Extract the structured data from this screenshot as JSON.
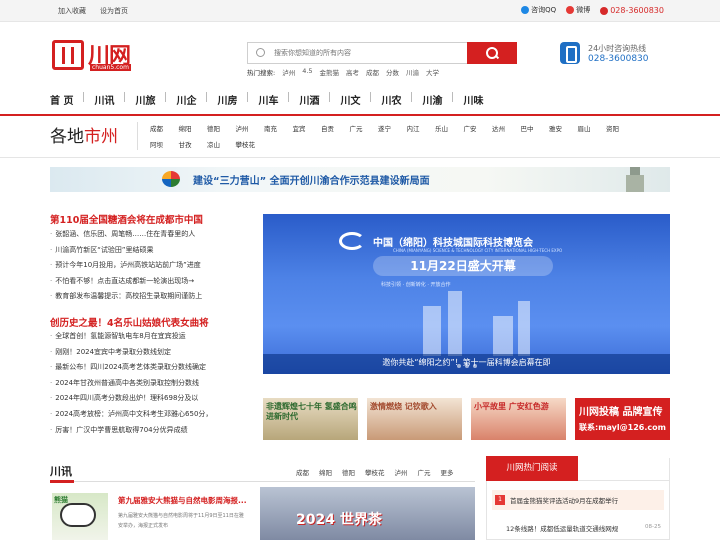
{
  "topbar": {
    "links": [
      "加入收藏",
      "设为首页"
    ],
    "qq": "咨询QQ",
    "weibo": "微博",
    "phone": "028-3600830"
  },
  "logo": {
    "cn": "川网",
    "en": "chuan5.com"
  },
  "search": {
    "placeholder": "搜索你想知道的所有内容",
    "hot_label": "热门搜索:",
    "hot_words": [
      "泸州",
      "4.5",
      "金熊猫",
      "高考",
      "成都",
      "分数",
      "川渝",
      "大学"
    ]
  },
  "hotline": {
    "label": "24小时咨询热线",
    "phone": "028-3600830"
  },
  "main_nav": [
    "首 页",
    "川讯",
    "川旅",
    "川企",
    "川房",
    "川车",
    "川酒",
    "川文",
    "川农",
    "川渝",
    "川味"
  ],
  "regions": {
    "title_black": "各地",
    "title_red": "市州",
    "items": [
      "成都",
      "绵阳",
      "德阳",
      "泸州",
      "南充",
      "宜宾",
      "自贡",
      "广元",
      "遂宁",
      "内江",
      "乐山",
      "广安",
      "达州",
      "巴中",
      "雅安",
      "眉山",
      "资阳",
      "阿坝",
      "甘孜",
      "凉山",
      "攀枝花"
    ]
  },
  "banner": {
    "text": "建设“三力营山” 全面开创川渝合作示范县建设新局面"
  },
  "news": {
    "group1_title": "第110届全国糖酒会将在成都市中国",
    "group1_items": [
      "张韶涵、信乐团、周笔畅……住在青春里的人",
      "川渝高竹新区“试验田”里结硕果",
      "预计今年10月投用，泸州高铁站站前广场”进度",
      "不怕看不够！点击直达成都新一轮演出现场→",
      "教育部发布温馨提示：高校招生录取期间谨防上"
    ],
    "group2_title": "创历史之最！4名乐山姑娘代表女曲将",
    "group2_items": [
      "全球首创！氢能源智轨电车8月在宜宾投运",
      "刚刚！2024宜宾中考录取分数线划定",
      "最新公布！四川2024高考艺体类录取分数线确定",
      "2024年甘孜州普通高中各类别录取控制分数线",
      "2024年四川高考分数段出炉！理科698分及以",
      "2024高考放榜：泸州高中文科考生邓雅心650分，",
      "厉害！广汉中学曹思航取得704分优异成绩"
    ]
  },
  "big_image": {
    "title": "中国（绵阳）科技城国际科技博览会",
    "subtitle_en": "CHINA (MIANYANG) SCIENCE & TECHNOLOGY CITY INTERNATIONAL HIGH-TECH EXPO",
    "date_banner": "11月22日盛大开幕",
    "slogan": "科技引领 · 创新转化 · 开放合作",
    "caption": "邀你共赴“绵阳之约”！第十一届科博会启幕在即"
  },
  "thumbs": [
    {
      "text": "非遗辉煌七十年 氢盛合鸣进新时代",
      "color": "#2d6a2f"
    },
    {
      "text": "激情燃烧 记钦歌入",
      "color": "#a34b2f"
    },
    {
      "text": "小平故里 广安红色游",
      "color": "#c62828"
    },
    {
      "title": "川网投稿 品牌宣传",
      "email": "联系:mayl@126.com",
      "color": "#d42020"
    }
  ],
  "section": {
    "title": "川讯",
    "nav": [
      "成都",
      "绵阳",
      "德阳",
      "攀枝花",
      "泸州",
      "广元",
      "更多"
    ],
    "feature_title": "第九届雅安大熊猫与自然电影周海报...",
    "feature_desc": "第九届雅安大熊猫与自然电影周将于11月9日至11日在雅安举办，海报正式发布",
    "feature_img_label": "熊猫",
    "feature2_overlay": "2024 世界茶"
  },
  "hot_read": {
    "tab": "川网热门阅读",
    "items": [
      {
        "num": "1",
        "text": "首届金熊猫奖评选活动9月在成都举行"
      },
      {
        "num": "2",
        "text": "12条线路！成都低运量轨道交通线网规",
        "date": "08-25"
      }
    ]
  }
}
